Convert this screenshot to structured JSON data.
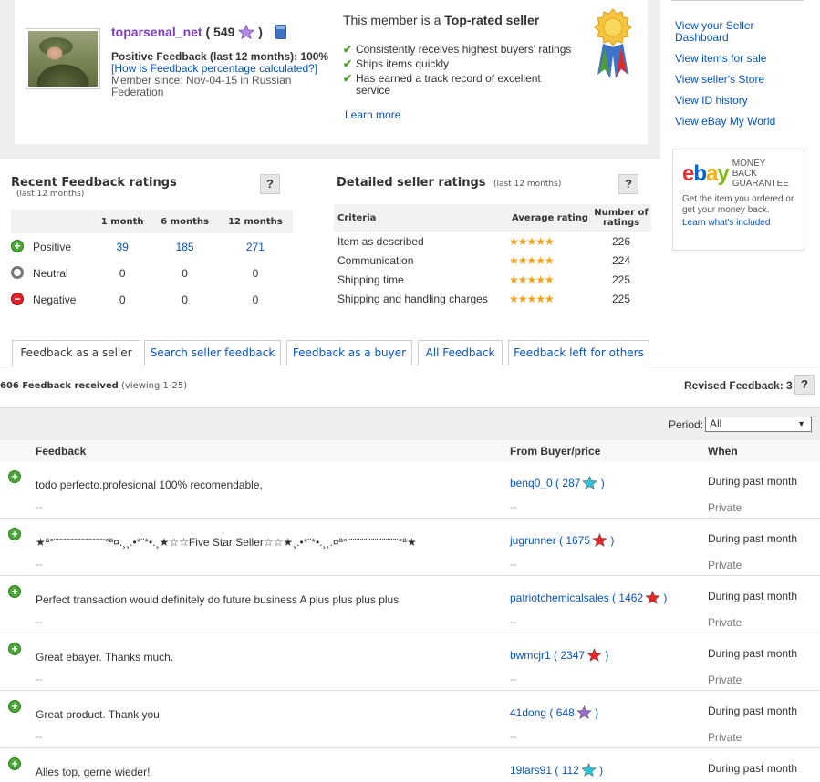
{
  "profile": {
    "seller_name": "toparsenal_net",
    "score_open": "(",
    "score": "549",
    "score_close": ")",
    "positive_feedback": "Positive Feedback (last 12 months): 100%",
    "calc_link": "[How is Feedback percentage calculated?]",
    "member_since": "Member since: Nov-04-15 in Russian Federation",
    "top_rated_prefix": "This member is a",
    "top_rated_bold": "Top-rated seller",
    "top_rated_items": [
      "Consistently receives highest buyers' ratings",
      "Ships items quickly",
      "Has earned a track record of excellent service"
    ],
    "learn_more": "Learn more",
    "star_color_purple": "#9b6bcf"
  },
  "sidebar": {
    "links": [
      "View your Seller Dashboard",
      "View items for sale",
      "View seller's Store",
      "View ID history",
      "View eBay My World"
    ],
    "mbg_title": "MONEY BACK GUARANTEE",
    "mbg_desc": "Get the item you ordered or get your money back.",
    "mbg_link": "Learn what's included"
  },
  "recent": {
    "title": "Recent Feedback ratings",
    "subtitle": "(last 12 months)",
    "help": "?",
    "columns": [
      "",
      "1 month",
      "6 months",
      "12 months"
    ],
    "rows": [
      {
        "label": "Positive",
        "m1": "39",
        "m6": "185",
        "m12": "271"
      },
      {
        "label": "Neutral",
        "m1": "0",
        "m6": "0",
        "m12": "0"
      },
      {
        "label": "Negative",
        "m1": "0",
        "m6": "0",
        "m12": "0"
      }
    ]
  },
  "dsr": {
    "title": "Detailed seller ratings",
    "subtitle": "(last 12 months)",
    "help": "?",
    "columns": [
      "Criteria",
      "Average rating",
      "Number of ratings"
    ],
    "rows": [
      {
        "criteria": "Item as described",
        "stars": "★★★★★",
        "count": "226"
      },
      {
        "criteria": "Communication",
        "stars": "★★★★★",
        "count": "224"
      },
      {
        "criteria": "Shipping time",
        "stars": "★★★★★",
        "count": "225"
      },
      {
        "criteria": "Shipping and handling charges",
        "stars": "★★★★★",
        "count": "225"
      }
    ]
  },
  "tabs": [
    "Feedback as a seller",
    "Search seller feedback",
    "Feedback as a buyer",
    "All Feedback",
    "Feedback left for others"
  ],
  "summary": {
    "received_bold": "606 Feedback received",
    "received_view": "(viewing 1-25)",
    "revised": "Revised Feedback: 3",
    "help": "?"
  },
  "period": {
    "label": "Period:",
    "value": "All"
  },
  "feedback_table": {
    "headers": {
      "feedback": "Feedback",
      "from": "From Buyer/price",
      "when": "When"
    },
    "rows": [
      {
        "comment": "todo perfecto.profesional 100% recomendable,",
        "buyer": "benq0_0",
        "score": "287",
        "star": "#2ec4d8",
        "when": "During past month",
        "price": "Private",
        "dash": "--"
      },
      {
        "comment": "★ª°¨¨¨¨¨¨¨¨¨¨¨¨¨¨°ª¤.¸¸.•*¨*•.¸★☆☆Five Star Seller☆☆★¸.•*¨*•.¸¸.¤ª°¨¨¨¨¨¨¨¨¨¨¨¨¨¨°ª★",
        "buyer": "jugrunner",
        "score": "1675",
        "star": "#e02a2a",
        "when": "During past month",
        "price": "Private",
        "dash": "--"
      },
      {
        "comment": "Perfect transaction would definitely do future business A plus plus plus plus",
        "buyer": "patriotchemicalsales",
        "score": "1462",
        "star": "#e02a2a",
        "when": "During past month",
        "price": "Private",
        "dash": "--"
      },
      {
        "comment": "Great ebayer. Thanks much.",
        "buyer": "bwmcjr1",
        "score": "2347",
        "star": "#e02a2a",
        "when": "During past month",
        "price": "Private",
        "dash": "--"
      },
      {
        "comment": "Great product. Thank you",
        "buyer": "41dong",
        "score": "648",
        "star": "#9b6bcf",
        "when": "During past month",
        "price": "Private",
        "dash": "--"
      },
      {
        "comment": "Alles top, gerne wieder!",
        "buyer": "19lars91",
        "score": "112",
        "star": "#2ec4d8",
        "when": "During past month",
        "price": "Private",
        "dash": "--"
      }
    ]
  }
}
